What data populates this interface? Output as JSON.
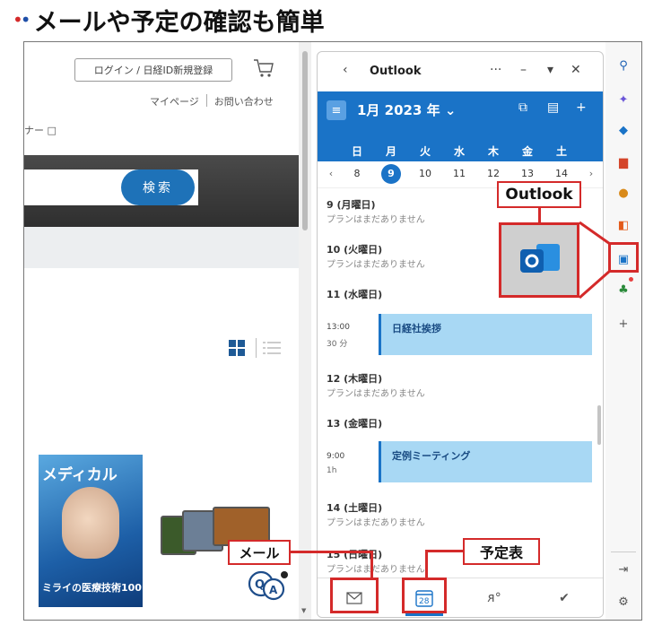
{
  "heading": {
    "dots": "••",
    "title": "メールや予定の確認も簡単"
  },
  "web": {
    "login_label": "ログイン / 日経ID新規登録",
    "mypage": "マイページ",
    "contact": "お問い合わせ",
    "nav_stub": "ナー",
    "search_label": "検索",
    "magazine_title": "メディカル",
    "magazine_footer": "ミライの医療技術100"
  },
  "outlook": {
    "title": "Outlook",
    "month_label": "1月 2023 年",
    "weekdays": [
      "日",
      "月",
      "火",
      "水",
      "木",
      "金",
      "土"
    ],
    "dates": [
      "8",
      "9",
      "10",
      "11",
      "12",
      "13",
      "14"
    ],
    "selected_date": "9",
    "days": [
      {
        "head": "9 (月曜日)",
        "sub": "プランはまだありません"
      },
      {
        "head": "10 (火曜日)",
        "sub": "プランはまだありません"
      },
      {
        "head": "11 (水曜日)",
        "sub": ""
      },
      {
        "head": "12 (木曜日)",
        "sub": "プランはまだありません"
      },
      {
        "head": "13 (金曜日)",
        "sub": ""
      },
      {
        "head": "14 (土曜日)",
        "sub": "プランはまだありません"
      },
      {
        "head": "15 (日曜日)",
        "sub": "プランはまだありません"
      }
    ],
    "events": [
      {
        "time": "13:00",
        "duration": "30 分",
        "title": "日経社挨拶"
      },
      {
        "time": "9:00",
        "duration": "1h",
        "title": "定例ミーティング"
      }
    ],
    "calendar_icon_day": "28"
  },
  "callouts": {
    "outlook": "Outlook",
    "mail": "メール",
    "calendar": "予定表"
  },
  "colors": {
    "accent": "#1a73c7",
    "callout_red": "#d42a2a",
    "event_bg": "#a8d8f4"
  },
  "icons": {
    "sidebar": [
      "search-icon",
      "copilot-icon",
      "tag-icon",
      "toolbox-icon",
      "people-icon",
      "office-icon",
      "outlook-icon",
      "tree-icon",
      "add-icon"
    ],
    "bottom_tabs": [
      "mail-icon",
      "calendar-icon",
      "people-icon",
      "todo-icon"
    ]
  }
}
